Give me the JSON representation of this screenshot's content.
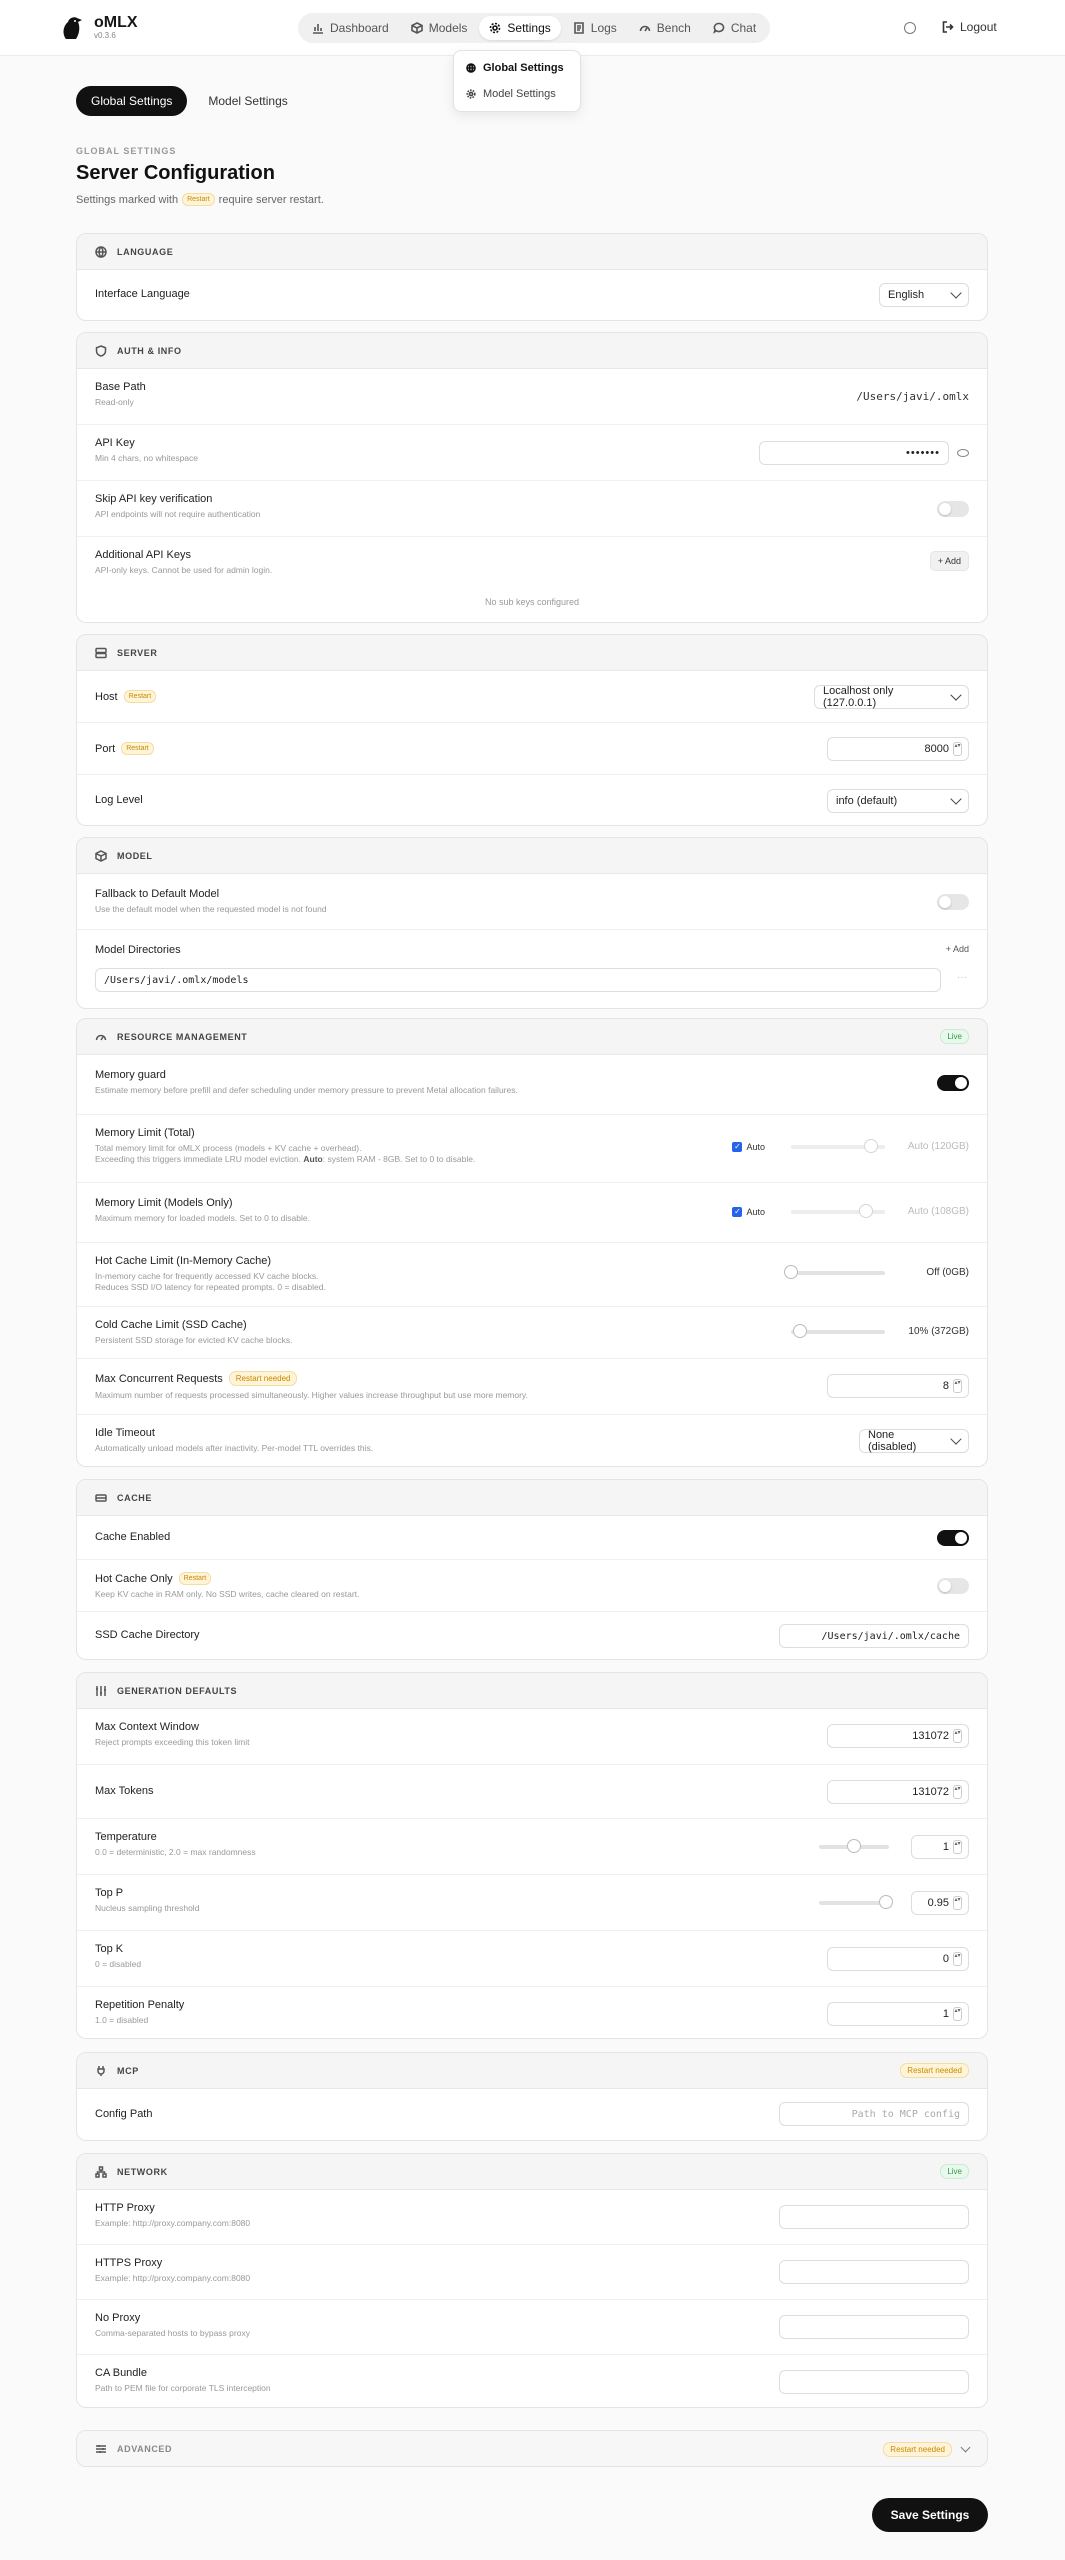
{
  "app": {
    "name": "oMLX",
    "version": "v0.3.6"
  },
  "nav": {
    "items": [
      {
        "label": "Dashboard",
        "icon": "bar-chart-icon"
      },
      {
        "label": "Models",
        "icon": "cube-icon"
      },
      {
        "label": "Settings",
        "icon": "gear-icon",
        "active": true
      },
      {
        "label": "Logs",
        "icon": "file-list-icon"
      },
      {
        "label": "Bench",
        "icon": "gauge-icon"
      },
      {
        "label": "Chat",
        "icon": "chat-bubble-icon"
      }
    ],
    "logout": "Logout"
  },
  "settings_menu": [
    "Global Settings",
    "Model Settings"
  ],
  "tabs": [
    "Global Settings",
    "Model Settings"
  ],
  "header": {
    "kicker": "GLOBAL SETTINGS",
    "title": "Server Configuration",
    "sub_before": "Settings marked with",
    "badge": "Restart",
    "sub_after": "require server restart."
  },
  "badges": {
    "restart": "Restart",
    "restart_needed": "Restart needed",
    "live": "Live"
  },
  "language": {
    "title": "LANGUAGE",
    "interface_label": "Interface Language",
    "interface_value": "English"
  },
  "auth": {
    "title": "AUTH & INFO",
    "base_path_label": "Base Path",
    "base_path_desc": "Read-only",
    "base_path_value": "/Users/javi/.omlx",
    "api_key_label": "API Key",
    "api_key_desc": "Min 4 chars, no whitespace",
    "api_key_value": "•••••••",
    "skip_label": "Skip API key verification",
    "skip_desc": "API endpoints will not require authentication",
    "skip_on": false,
    "additional_label": "Additional API Keys",
    "additional_desc": "API-only keys. Cannot be used for admin login.",
    "add_button": "+ Add",
    "empty_text": "No sub keys configured"
  },
  "server": {
    "title": "SERVER",
    "host_label": "Host",
    "host_value": "Localhost only (127.0.0.1)",
    "port_label": "Port",
    "port_value": "8000",
    "log_label": "Log Level",
    "log_value": "info (default)"
  },
  "model": {
    "title": "MODEL",
    "fallback_label": "Fallback to Default Model",
    "fallback_desc": "Use the default model when the requested model is not found",
    "fallback_on": false,
    "dirs_label": "Model Directories",
    "add_button": "+ Add",
    "dir_value": "/Users/javi/.omlx/models",
    "dir_menu": "···"
  },
  "resource": {
    "title": "RESOURCE MANAGEMENT",
    "memory_guard_label": "Memory guard",
    "memory_guard_desc": "Estimate memory before prefill and defer scheduling under memory pressure to prevent Metal allocation failures.",
    "memory_guard_on": true,
    "mem_total_label": "Memory Limit (Total)",
    "mem_total_desc1": "Total memory limit for oMLX process (models + KV cache + overhead).",
    "mem_total_desc2a": "Exceeding this triggers immediate LRU model eviction.",
    "mem_total_desc2b": "Auto",
    "mem_total_desc2c": ": system RAM - 8GB. Set to 0 to disable.",
    "mem_total_auto": "Auto",
    "mem_total_value": "Auto (120GB)",
    "mem_total_level": 0.85,
    "mem_models_label": "Memory Limit (Models Only)",
    "mem_models_desc": "Maximum memory for loaded models. Set to 0 to disable.",
    "mem_models_auto": "Auto",
    "mem_models_value": "Auto (108GB)",
    "mem_models_level": 0.8,
    "hot_label": "Hot Cache Limit (In-Memory Cache)",
    "hot_desc1": "In-memory cache for frequently accessed KV cache blocks.",
    "hot_desc2": "Reduces SSD I/O latency for repeated prompts. 0 = disabled.",
    "hot_value": "Off (0GB)",
    "hot_level": 0.0,
    "cold_label": "Cold Cache Limit (SSD Cache)",
    "cold_desc": "Persistent SSD storage for evicted KV cache blocks.",
    "cold_value": "10% (372GB)",
    "cold_level": 0.1,
    "max_req_label": "Max Concurrent Requests",
    "max_req_desc": "Maximum number of requests processed simultaneously. Higher values increase throughput but use more memory.",
    "max_req_value": "8",
    "idle_label": "Idle Timeout",
    "idle_desc": "Automatically unload models after inactivity. Per-model TTL overrides this.",
    "idle_value": "None (disabled)"
  },
  "cache": {
    "title": "CACHE",
    "enabled_label": "Cache Enabled",
    "enabled_on": true,
    "hot_only_label": "Hot Cache Only",
    "hot_only_desc": "Keep KV cache in RAM only. No SSD writes, cache cleared on restart.",
    "hot_only_on": false,
    "ssd_dir_label": "SSD Cache Directory",
    "ssd_dir_value": "/Users/javi/.omlx/cache"
  },
  "generation": {
    "title": "GENERATION DEFAULTS",
    "ctx_label": "Max Context Window",
    "ctx_desc": "Reject prompts exceeding this token limit",
    "ctx_value": "131072",
    "tokens_label": "Max Tokens",
    "tokens_value": "131072",
    "temp_label": "Temperature",
    "temp_desc": "0.0 = deterministic, 2.0 = max randomness",
    "temp_value": "1",
    "temp_level": 0.5,
    "topp_label": "Top P",
    "topp_desc": "Nucleus sampling threshold",
    "topp_value": "0.95",
    "topp_level": 0.95,
    "topk_label": "Top K",
    "topk_desc": "0 = disabled",
    "topk_value": "0",
    "rep_label": "Repetition Penalty",
    "rep_desc": "1.0 = disabled",
    "rep_value": "1"
  },
  "mcp": {
    "title": "MCP",
    "config_label": "Config Path",
    "config_placeholder": "Path to MCP config"
  },
  "network": {
    "title": "NETWORK",
    "http_label": "HTTP Proxy",
    "http_desc": "Example: http://proxy.company.com:8080",
    "https_label": "HTTPS Proxy",
    "https_desc": "Example: http://proxy.company.com:8080",
    "no_proxy_label": "No Proxy",
    "no_proxy_desc": "Comma-separated hosts to bypass proxy",
    "ca_label": "CA Bundle",
    "ca_desc": "Path to PEM file for corporate TLS interception"
  },
  "advanced": {
    "title": "ADVANCED"
  },
  "save_button": "Save Settings"
}
